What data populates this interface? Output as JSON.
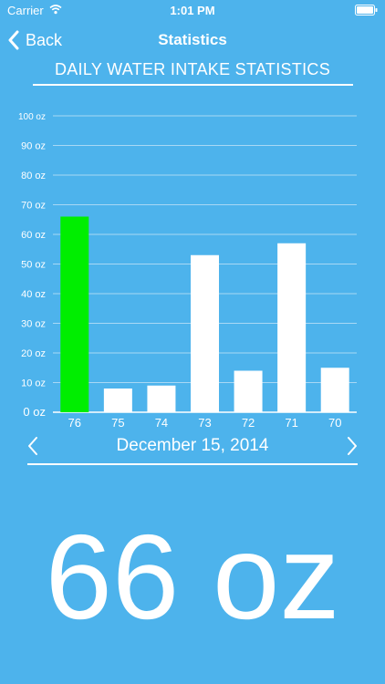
{
  "status_bar": {
    "carrier": "Carrier",
    "time": "1:01 PM",
    "wifi_icon": "wifi-icon",
    "battery_icon": "battery-icon"
  },
  "nav": {
    "back_label": "Back",
    "back_icon": "chevron-left-icon",
    "title": "Statistics"
  },
  "heading": "DAILY WATER INTAKE STATISTICS",
  "chart_data": {
    "type": "bar",
    "title": "",
    "xlabel": "",
    "ylabel": "",
    "categories": [
      "76",
      "75",
      "74",
      "73",
      "72",
      "71",
      "70"
    ],
    "values": [
      66,
      8,
      9,
      53,
      14,
      57,
      15
    ],
    "ylim": [
      0,
      100
    ],
    "y_ticks": [
      0,
      10,
      20,
      30,
      40,
      50,
      60,
      70,
      80,
      90,
      100
    ],
    "y_tick_labels": [
      "0 oz",
      "10 oz",
      "20 oz",
      "30 oz",
      "40 oz",
      "50 oz",
      "60 oz",
      "70 oz",
      "80 oz",
      "90 oz",
      "100 oz"
    ],
    "grid": true,
    "legend": "none",
    "selected_index": 0,
    "colors": {
      "bar": "#ffffff",
      "selected_bar": "#00ee00",
      "grid": "#a8d8f5"
    }
  },
  "date_nav": {
    "date": "December 15, 2014",
    "prev_icon": "chevron-left-icon",
    "next_icon": "chevron-right-icon"
  },
  "total": "66 oz",
  "colors": {
    "background": "#4db3ec",
    "foreground": "#ffffff"
  }
}
